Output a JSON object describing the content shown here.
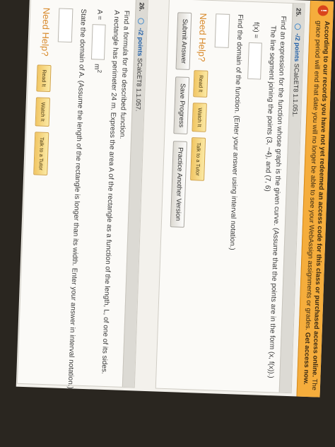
{
  "banner": {
    "icon": "alert-icon",
    "prefix": "According to our records you have not yet redeemed an access code for this class or purchased access online.",
    "rest": " The grace period will end that date you will no longer be able to see your WebAssign assignments or grades.",
    "link": "Get access now."
  },
  "q25": {
    "number": "25.",
    "points": "-/2 points",
    "source": "SCalcET8 1.1.051.",
    "prompt": "Find an expression for the function whose graph is the given curve. (Assume that the points are in the form (x, f(x)).)",
    "subprompt": "The line segment joining the points (3, −4), and (7, 6)",
    "fx_label": "f(x) =",
    "fx_value": "",
    "domain_prompt": "Find the domain of the function. (Enter your answer using interval notation.)",
    "domain_value": "",
    "need_help": "Need Help?",
    "read_it": "Read It",
    "watch_it": "Watch It",
    "talk_tutor": "Talk to a Tutor",
    "submit": "Submit Answer",
    "save": "Save Progress",
    "practice": "Practice Another Version"
  },
  "q26": {
    "number": "26.",
    "points": "-/2 points",
    "source": "SCalcET8 1.1.057.",
    "prompt": "Find a formula for the described function.",
    "subprompt": "A rectangle has perimeter 24 m. Express the area A of the rectangle as a function of the length, L, of one of its sides.",
    "a_label": "A =",
    "a_value": "",
    "unit": "m",
    "unit_sup": "2",
    "domain_prompt": "State the domain of A. (Assume the length of the rectangle is longer than its width. Enter your answer in interval notation.)",
    "domain_value": "",
    "need_help": "Need Help?",
    "read_it": "Read It",
    "watch_it": "Watch It",
    "talk_tutor": "Talk to a Tutor"
  },
  "colors": {
    "banner": "#f5ad3c",
    "need_help": "#d8892a",
    "points_link": "#1f5fa8",
    "page_bg": "#f3f1ec"
  }
}
